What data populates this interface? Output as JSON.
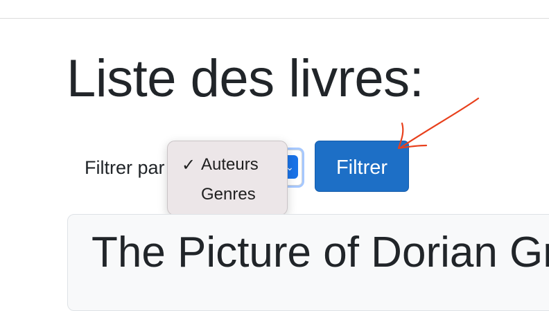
{
  "page": {
    "title": "Liste des livres:"
  },
  "filter": {
    "label": "Filtrer par",
    "button_label": "Filtrer",
    "selected": "Auteurs",
    "options": [
      {
        "label": "Auteurs",
        "checked": true
      },
      {
        "label": "Genres",
        "checked": false
      }
    ],
    "check_glyph": "✓"
  },
  "books": [
    {
      "title": "The Picture of Dorian Gray"
    }
  ],
  "colors": {
    "primary_button": "#1d6fc6",
    "annotation_arrow": "#e8401c",
    "dropdown_bg": "#ece6e8"
  }
}
